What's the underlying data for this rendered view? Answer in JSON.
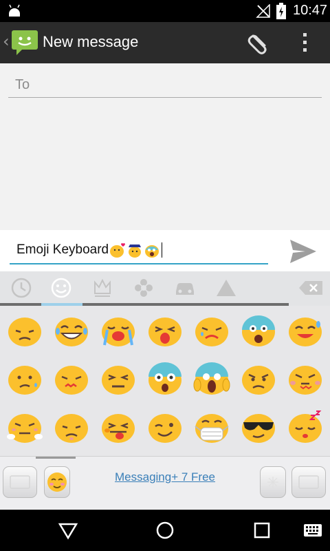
{
  "status_bar": {
    "time": "10:47",
    "icons": [
      "android-icon",
      "no-signal-icon",
      "battery-charging-icon"
    ]
  },
  "action_bar": {
    "title": "New message",
    "icons": [
      "back-chevron-icon",
      "messaging-app-icon",
      "paperclip-icon",
      "overflow-menu-icon"
    ]
  },
  "compose": {
    "to_placeholder": "To",
    "message_text": "Emoji Keyboard"
  },
  "keyboard": {
    "categories": [
      "recent-clock-icon",
      "smiley-face-icon",
      "crown-icon",
      "flower-icon",
      "car-icon",
      "triangle-symbol-icon"
    ],
    "active_category": "smiley-face-icon",
    "emoji_rows": [
      [
        "disappointed-face",
        "grinning-tears-face",
        "loudly-crying-face",
        "tired-face",
        "persevering-face",
        "fearful-face",
        "smiling-sweat-face"
      ],
      [
        "confused-face",
        "confounded-face",
        "squinting-face",
        "scared-face",
        "screaming-face",
        "angry-face",
        "pouting-face"
      ],
      [
        "steam-face",
        "worried-face",
        "tongue-face",
        "winking-face",
        "mask-face",
        "sunglasses-face",
        "sleeping-face"
      ]
    ],
    "promo_text": "Messaging+ 7 Free"
  },
  "colors": {
    "accent": "#33a3c6",
    "emoji_yellow": "#fbc02d",
    "link": "#3a7fb8"
  }
}
